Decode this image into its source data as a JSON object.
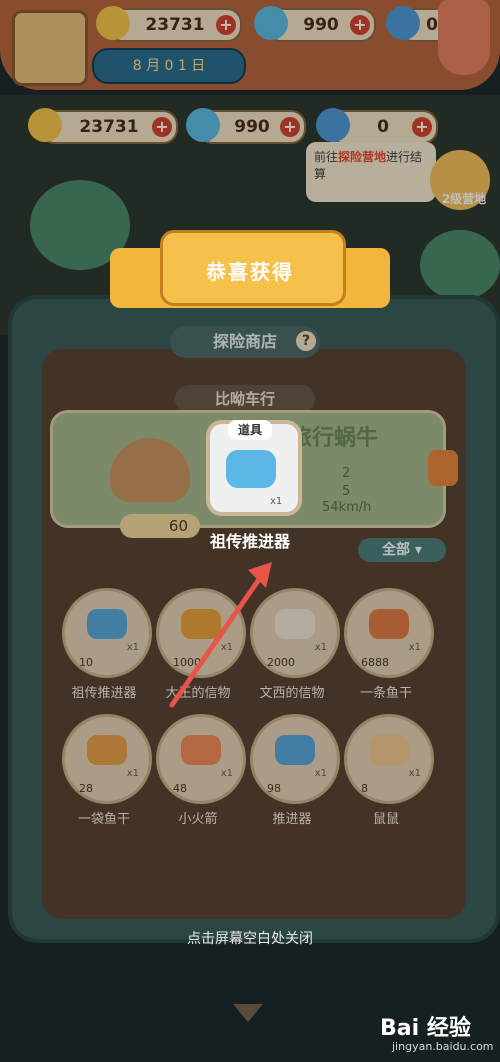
{
  "top_resources": {
    "bananas": "23731",
    "blue_flame": "990",
    "fish": "0"
  },
  "date": "8 月 0 1 日",
  "resources": {
    "bananas": "23731",
    "blue_flame": "990",
    "fish": "0"
  },
  "toast": {
    "prefix": "前往",
    "highlight": "探险营地",
    "suffix": "进行结算"
  },
  "level_badge": "2级营地",
  "popup": {
    "title": "恭喜获得",
    "tag": "道具",
    "item_name": "祖传推进器",
    "quantity": "x1"
  },
  "shop": {
    "title": "探险商店",
    "tab": "比呦车行",
    "card": {
      "name": "旅行蜗牛",
      "stat1": "2",
      "stat2": "5",
      "speed": "54km/h",
      "price": "60"
    },
    "filter": "全部",
    "items": [
      {
        "name": "祖传推进器",
        "cost": "10",
        "qty": "x1"
      },
      {
        "name": "大王的信物",
        "cost": "1000",
        "qty": "x1"
      },
      {
        "name": "文西的信物",
        "cost": "2000",
        "qty": "x1"
      },
      {
        "name": "一条鱼干",
        "cost": "6888",
        "qty": "x1"
      },
      {
        "name": "一袋鱼干",
        "cost": "28",
        "qty": "x1"
      },
      {
        "name": "小火箭",
        "cost": "48",
        "qty": "x1"
      },
      {
        "name": "推进器",
        "cost": "98",
        "qty": "x1"
      },
      {
        "name": "鼠鼠",
        "cost": "8",
        "qty": "x1"
      }
    ]
  },
  "close_hint": "点击屏幕空白处关闭",
  "watermark": {
    "logo": "Bai 经验",
    "url": "jingyan.baidu.com"
  },
  "colors": {
    "accent": "#f2b63c",
    "arrow": "#e8544a"
  }
}
